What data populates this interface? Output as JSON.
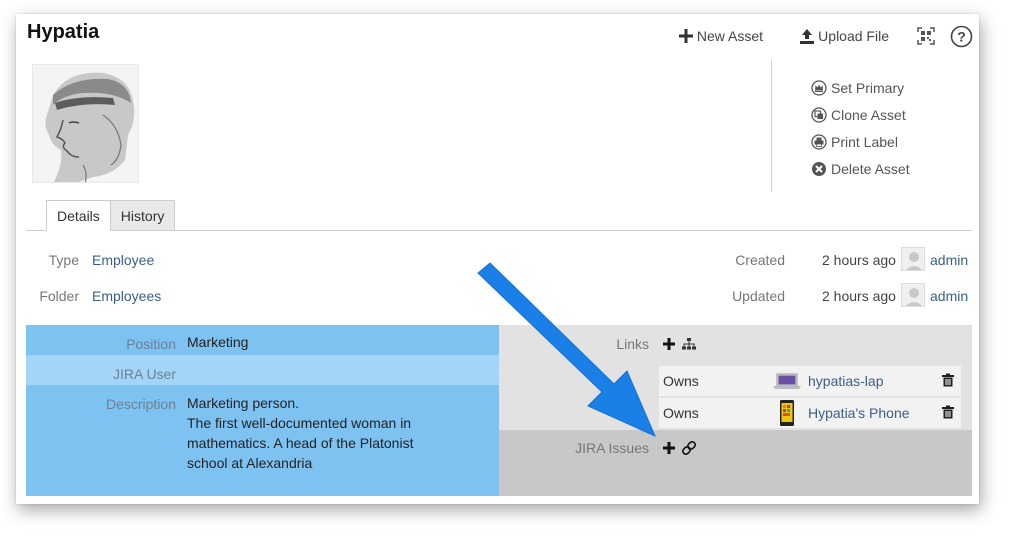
{
  "asset": {
    "title": "Hypatia"
  },
  "toolbar": {
    "new_asset": "New Asset",
    "upload_file": "Upload File"
  },
  "actions": [
    {
      "label": "Set Primary",
      "icon": "crown-icon"
    },
    {
      "label": "Clone Asset",
      "icon": "clone-icon"
    },
    {
      "label": "Print Label",
      "icon": "print-icon"
    },
    {
      "label": "Delete Asset",
      "icon": "delete-icon"
    }
  ],
  "tabs": [
    {
      "label": "Details",
      "active": true
    },
    {
      "label": "History",
      "active": false
    }
  ],
  "meta": {
    "type_label": "Type",
    "type_value": "Employee",
    "folder_label": "Folder",
    "folder_value": "Employees",
    "created_label": "Created",
    "created_value": "2 hours ago",
    "created_by": "admin",
    "updated_label": "Updated",
    "updated_value": "2 hours ago",
    "updated_by": "admin"
  },
  "fields": {
    "position_label": "Position",
    "position_value": "Marketing",
    "jira_user_label": "JIRA User",
    "jira_user_value": "",
    "description_label": "Description",
    "description_lines": [
      "Marketing person.",
      "The first well-documented woman in",
      "mathematics. A head of the Platonist",
      "school at Alexandria"
    ]
  },
  "links": {
    "label": "Links",
    "items": [
      {
        "relation": "Owns",
        "name": "hypatias-lap",
        "icon": "laptop-icon"
      },
      {
        "relation": "Owns",
        "name": "Hypatia's Phone",
        "icon": "phone-icon"
      }
    ]
  },
  "jira": {
    "label": "JIRA Issues"
  },
  "colors": {
    "left_panel": "#7ec2f2",
    "left_panel_highlight": "#a3d5f8",
    "right_panel": "#e2e2e2",
    "right_panel_lower": "#c8c8c8",
    "link": "#3a5f8a",
    "arrow": "#1a7fe6"
  }
}
